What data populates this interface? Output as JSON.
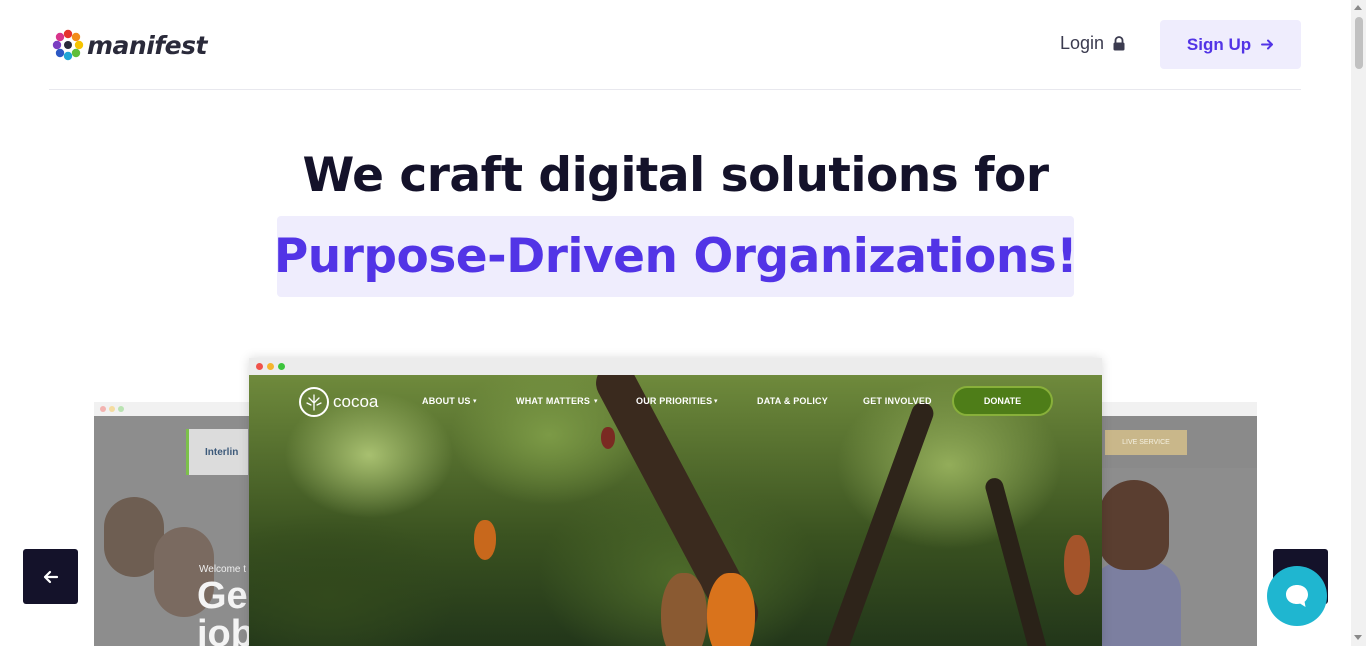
{
  "header": {
    "logo_text": "manifest",
    "login_label": "Login",
    "signup_label": "Sign Up"
  },
  "hero": {
    "line1": "We craft digital solutions for",
    "line2": "Purpose-Driven Organizations!"
  },
  "carousel": {
    "main_slide": {
      "logo_text": "cocoa",
      "nav": [
        "ABOUT US",
        "WHAT MATTERS",
        "OUR PRIORITIES",
        "DATA & POLICY",
        "GET INVOLVED"
      ],
      "donate_label": "DONATE"
    },
    "left_slide": {
      "brand": "Interlin",
      "welcome": "Welcome t",
      "headline": "Ge\njob"
    },
    "right_slide": {
      "button": "LIVE SERVICE"
    }
  },
  "colors": {
    "brand_purple": "#5234e6",
    "hero_highlight_bg": "#efedfd",
    "dark": "#14122a",
    "chat": "#1fb6d0",
    "donate_green": "#4e7d18"
  },
  "icons": [
    "lock-icon",
    "arrow-right-icon",
    "arrow-left-icon",
    "chat-icon",
    "chevron-down-icon"
  ]
}
